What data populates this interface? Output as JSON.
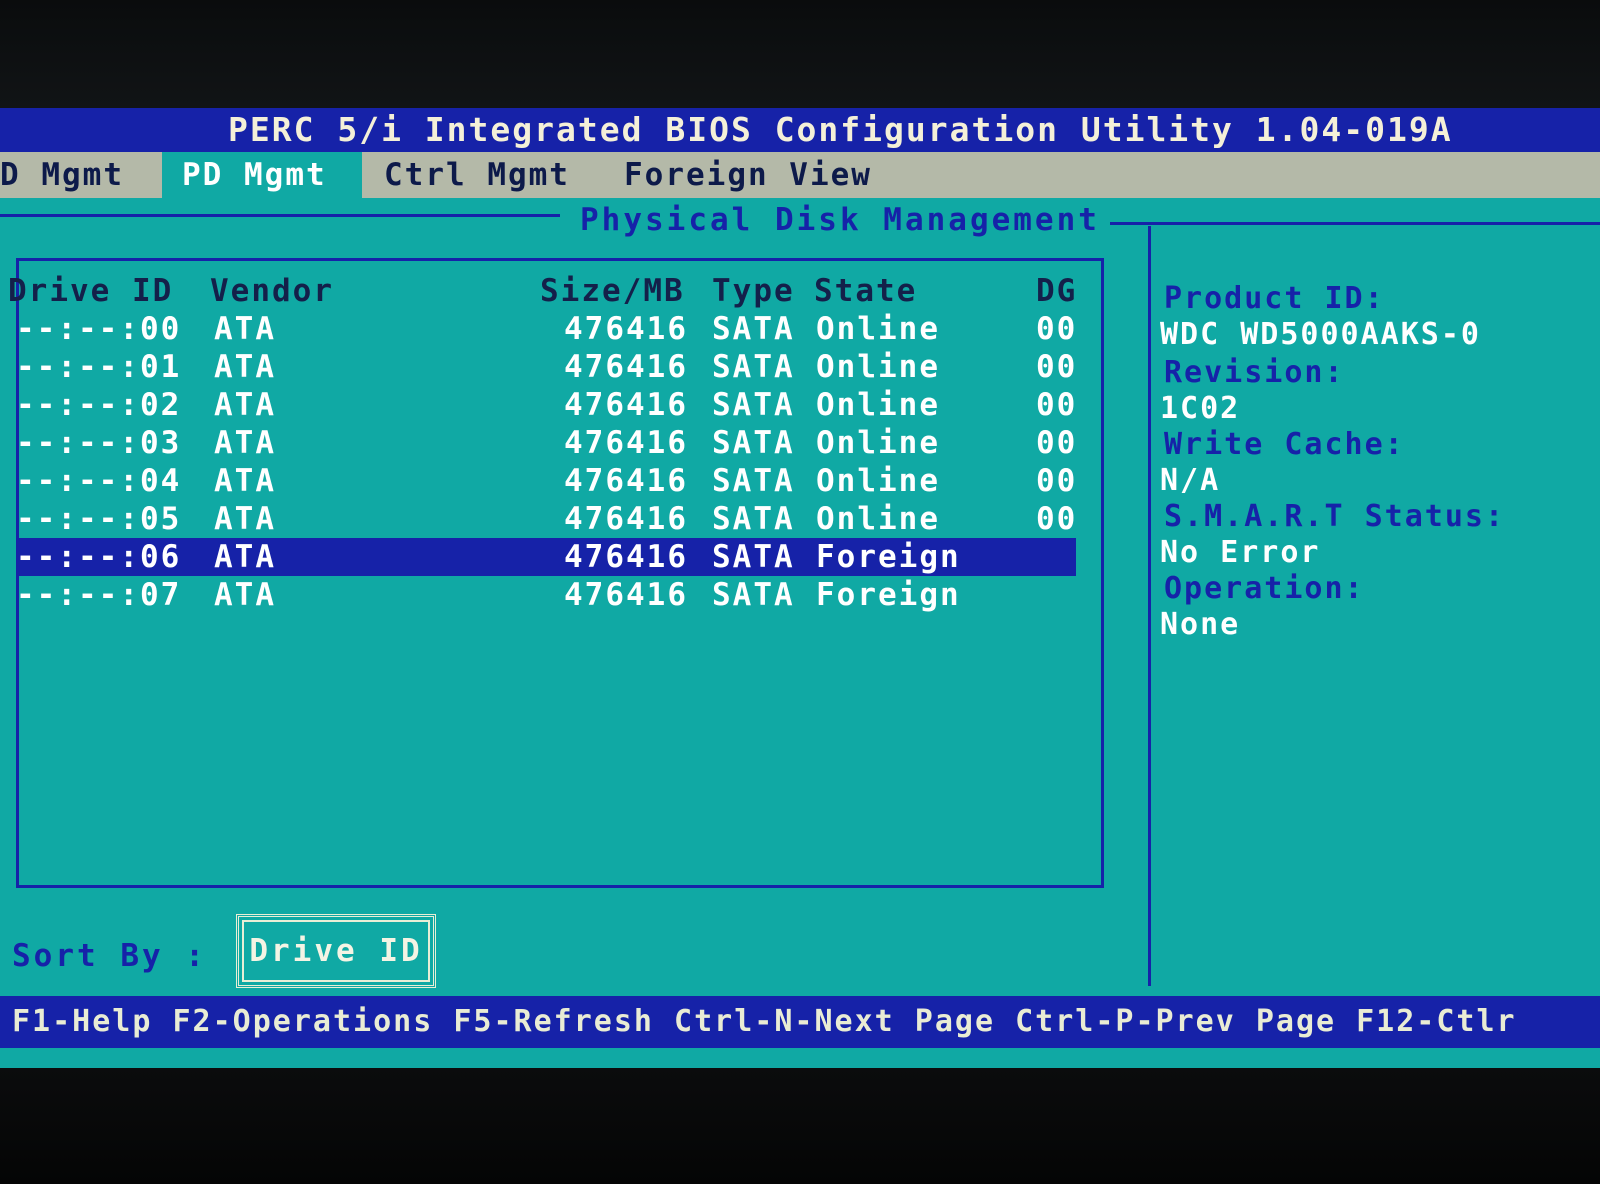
{
  "title_bar": {
    "title": "PERC 5/i Integrated BIOS Configuration Utility 1.04-019A"
  },
  "tabs": [
    {
      "label": "D Mgmt"
    },
    {
      "label": "PD Mgmt",
      "active": true
    },
    {
      "label": "Ctrl Mgmt"
    },
    {
      "label": "Foreign View"
    }
  ],
  "section_title": "Physical Disk Management",
  "table": {
    "headers": {
      "drive_id": "Drive ID",
      "vendor": "Vendor",
      "size": "Size/MB",
      "type": "Type",
      "state": "State",
      "dg": "DG"
    },
    "rows": [
      {
        "id": "--:--:00",
        "vendor": "ATA",
        "size": "476416",
        "type": "SATA",
        "state": "Online",
        "dg": "00"
      },
      {
        "id": "--:--:01",
        "vendor": "ATA",
        "size": "476416",
        "type": "SATA",
        "state": "Online",
        "dg": "00"
      },
      {
        "id": "--:--:02",
        "vendor": "ATA",
        "size": "476416",
        "type": "SATA",
        "state": "Online",
        "dg": "00"
      },
      {
        "id": "--:--:03",
        "vendor": "ATA",
        "size": "476416",
        "type": "SATA",
        "state": "Online",
        "dg": "00"
      },
      {
        "id": "--:--:04",
        "vendor": "ATA",
        "size": "476416",
        "type": "SATA",
        "state": "Online",
        "dg": "00"
      },
      {
        "id": "--:--:05",
        "vendor": "ATA",
        "size": "476416",
        "type": "SATA",
        "state": "Online",
        "dg": "00"
      },
      {
        "id": "--:--:06",
        "vendor": "ATA",
        "size": "476416",
        "type": "SATA",
        "state": "Foreign",
        "dg": ""
      },
      {
        "id": "--:--:07",
        "vendor": "ATA",
        "size": "476416",
        "type": "SATA",
        "state": "Foreign",
        "dg": ""
      }
    ],
    "selected_index": 6
  },
  "details": {
    "product_id_label": "Product ID:",
    "product_id_value": "WDC WD5000AAKS-0",
    "revision_label": "Revision:",
    "revision_value": "1C02",
    "write_cache_label": "Write Cache:",
    "write_cache_value": "N/A",
    "smart_label": "S.M.A.R.T Status:",
    "smart_value": "No Error",
    "operation_label": "Operation:",
    "operation_value": "None"
  },
  "sort": {
    "label": "Sort By :",
    "value": "Drive ID"
  },
  "status_bar": {
    "text": "F1-Help F2-Operations F5-Refresh Ctrl-N-Next Page Ctrl-P-Prev Page F12-Ctlr"
  },
  "colors": {
    "screen_bg": "#10a9a4",
    "bar_blue": "#1622a8",
    "tab_gray": "#b4b9a8",
    "text_white": "#ffffff"
  }
}
